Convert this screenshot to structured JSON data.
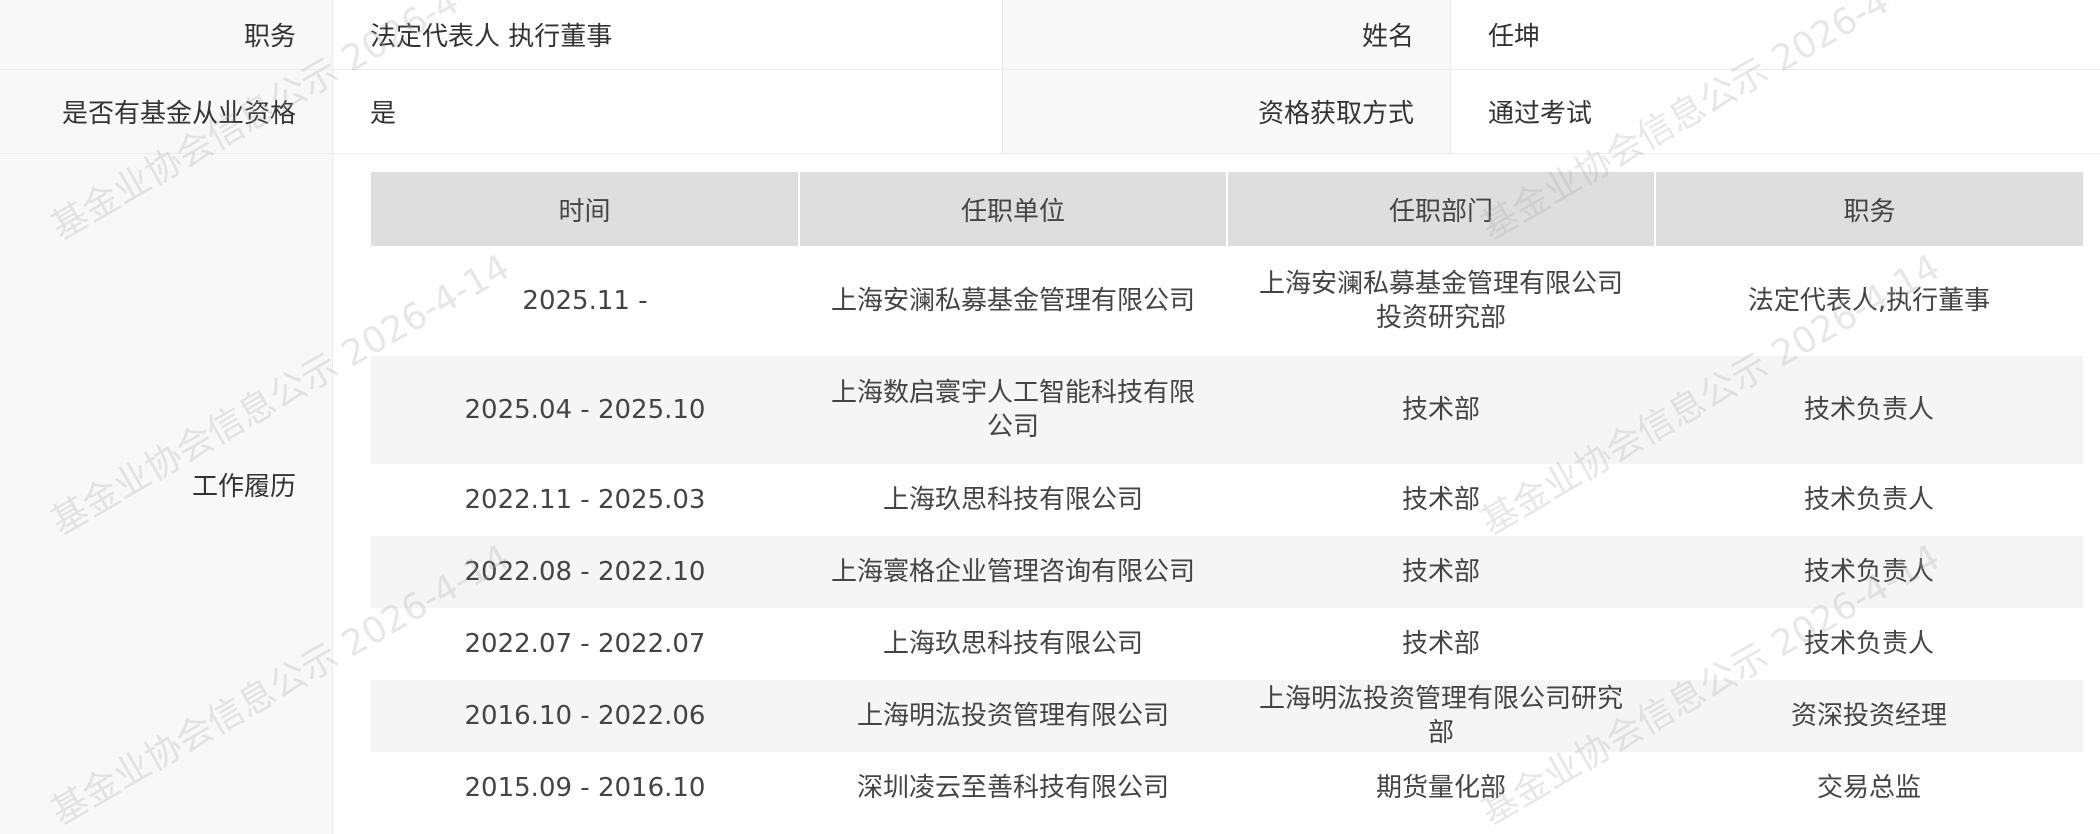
{
  "info": {
    "row1": {
      "label_left": "职务",
      "value_left": "法定代表人 执行董事",
      "label_right": "姓名",
      "value_right": "任坤"
    },
    "row2": {
      "label_left": "是否有基金从业资格",
      "value_left": "是",
      "label_right": "资格获取方式",
      "value_right": "通过考试"
    }
  },
  "history": {
    "label": "工作履历",
    "headers": [
      "时间",
      "任职单位",
      "任职部门",
      "职务"
    ],
    "rows": [
      [
        "2025.11 -",
        "上海安澜私募基金管理有限公司",
        "上海安澜私募基金管理有限公司投资研究部",
        "法定代表人,执行董事"
      ],
      [
        "2025.04 - 2025.10",
        "上海数启寰宇人工智能科技有限公司",
        "技术部",
        "技术负责人"
      ],
      [
        "2022.11 - 2025.03",
        "上海玖思科技有限公司",
        "技术部",
        "技术负责人"
      ],
      [
        "2022.08 - 2022.10",
        "上海寰格企业管理咨询有限公司",
        "技术部",
        "技术负责人"
      ],
      [
        "2022.07 - 2022.07",
        "上海玖思科技有限公司",
        "技术部",
        "技术负责人"
      ],
      [
        "2016.10 - 2022.06",
        "上海明汯投资管理有限公司",
        "上海明汯投资管理有限公司研究部",
        "资深投资经理"
      ],
      [
        "2015.09 - 2016.10",
        "深圳凌云至善科技有限公司",
        "期货量化部",
        "交易总监"
      ]
    ]
  },
  "watermark": "基金业协会信息公示 2026-4-14"
}
